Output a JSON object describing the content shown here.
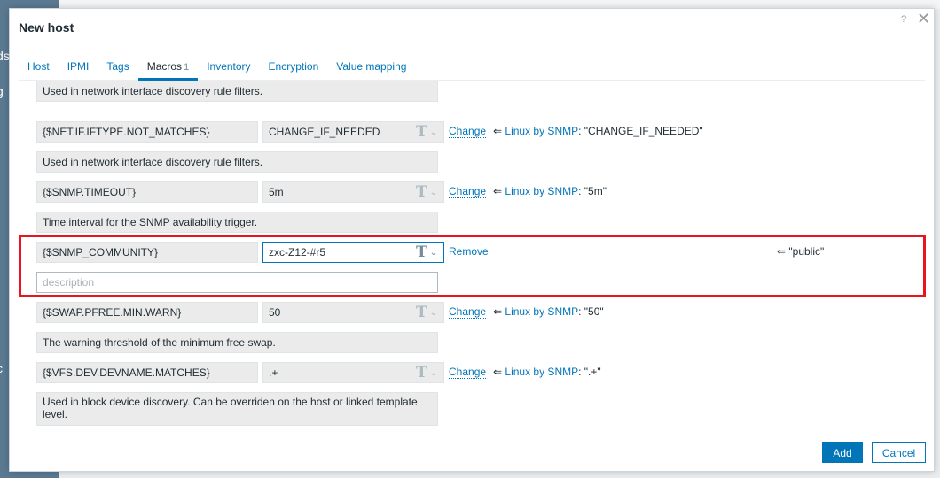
{
  "dialog": {
    "title": "New host",
    "help": "?",
    "close": "✕"
  },
  "tabs": [
    {
      "label": "Host"
    },
    {
      "label": "IPMI"
    },
    {
      "label": "Tags"
    },
    {
      "label": "Macros",
      "count": "1",
      "active": true
    },
    {
      "label": "Inventory"
    },
    {
      "label": "Encryption"
    },
    {
      "label": "Value mapping"
    }
  ],
  "macros": [
    {
      "description": "Used in network interface discovery rule filters."
    },
    {
      "macro": "{$NET.IF.IFTYPE.NOT_MATCHES}",
      "value": "CHANGE_IF_NEEDED",
      "action": "Change",
      "arrow": "⇐",
      "template": "Linux by SNMP",
      "inherited": ": \"CHANGE_IF_NEEDED\"",
      "description": "Used in network interface discovery rule filters."
    },
    {
      "macro": "{$SNMP.TIMEOUT}",
      "value": "5m",
      "action": "Change",
      "arrow": "⇐",
      "template": "Linux by SNMP",
      "inherited": ": \"5m\"",
      "description": "Time interval for the SNMP availability trigger."
    },
    {
      "macro": "{$SNMP_COMMUNITY}",
      "value": "zxc-Z12-#r5",
      "action": "Remove",
      "inherited_value": "⇐ \"public\"",
      "description_placeholder": "description"
    },
    {
      "macro": "{$SWAP.PFREE.MIN.WARN}",
      "value": "50",
      "action": "Change",
      "arrow": "⇐",
      "template": "Linux by SNMP",
      "inherited": ": \"50\"",
      "description": "The warning threshold of the minimum free swap."
    },
    {
      "macro": "{$VFS.DEV.DEVNAME.MATCHES}",
      "value": ".+",
      "action": "Change",
      "arrow": "⇐",
      "template": "Linux by SNMP",
      "inherited": ": \".+\"",
      "description": "Used in block device discovery. Can be overriden on the host or linked template level."
    }
  ],
  "type_button": {
    "glyph": "T",
    "chevron": "⌄"
  },
  "footer": {
    "add": "Add",
    "cancel": "Cancel"
  },
  "colors": {
    "accent": "#0275b8",
    "highlight": "#e8141e"
  }
}
